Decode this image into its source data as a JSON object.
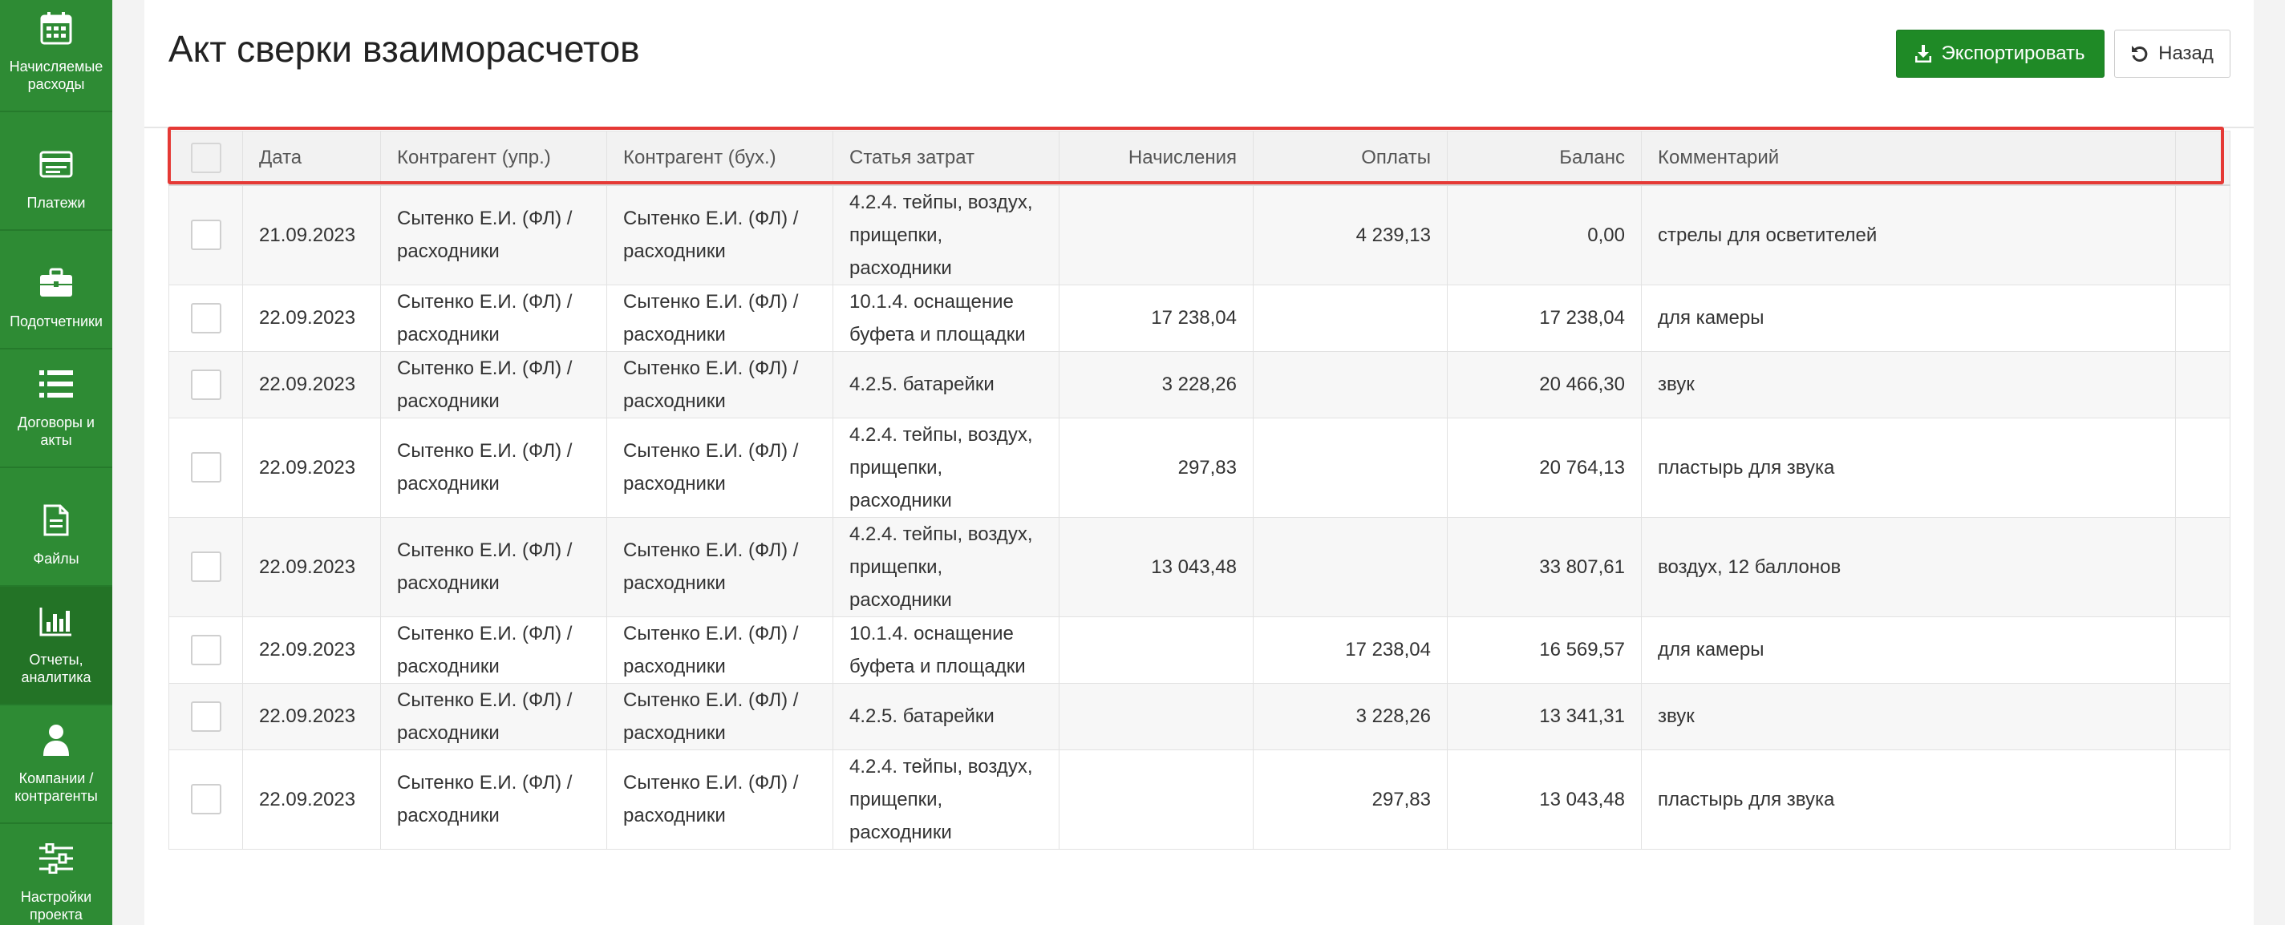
{
  "sidebar": {
    "items": [
      {
        "label": "Начисляемые\nрасходы",
        "icon": "calendar-icon"
      },
      {
        "label": "Платежи",
        "icon": "payments-icon"
      },
      {
        "label": "Подотчетники",
        "icon": "briefcase-icon"
      },
      {
        "label": "Договоры и\nакты",
        "icon": "list-icon"
      },
      {
        "label": "Файлы",
        "icon": "file-icon"
      },
      {
        "label": "Отчеты,\nаналитика",
        "icon": "bar-chart-icon"
      },
      {
        "label": "Компании /\nконтрагенты",
        "icon": "user-icon"
      },
      {
        "label": "Настройки\nпроекта",
        "icon": "sliders-icon"
      }
    ]
  },
  "page": {
    "title": "Акт сверки взаиморасчетов",
    "export_label": "Экспортировать",
    "back_label": "Назад"
  },
  "table": {
    "headers": [
      "Дата",
      "Контрагент (упр.)",
      "Контрагент (бух.)",
      "Статья затрат",
      "Начисления",
      "Оплаты",
      "Баланс",
      "Комментарий"
    ],
    "rows": [
      {
        "date": "21.09.2023",
        "contr_mgmt": "Сытенко Е.И. (ФЛ) / расходники",
        "contr_acc": "Сытенко Е.И. (ФЛ) / расходники",
        "article": "4.2.4. тейпы, воздух, прищепки, расходники",
        "accrual": "",
        "payment": "4 239,13",
        "balance": "0,00",
        "comment": "стрелы для осветителей"
      },
      {
        "date": "22.09.2023",
        "contr_mgmt": "Сытенко Е.И. (ФЛ) / расходники",
        "contr_acc": "Сытенко Е.И. (ФЛ) / расходники",
        "article": "10.1.4. оснащение буфета и площадки",
        "accrual": "17 238,04",
        "payment": "",
        "balance": "17 238,04",
        "comment": "для камеры"
      },
      {
        "date": "22.09.2023",
        "contr_mgmt": "Сытенко Е.И. (ФЛ) / расходники",
        "contr_acc": "Сытенко Е.И. (ФЛ) / расходники",
        "article": "4.2.5. батарейки",
        "accrual": "3 228,26",
        "payment": "",
        "balance": "20 466,30",
        "comment": "звук"
      },
      {
        "date": "22.09.2023",
        "contr_mgmt": "Сытенко Е.И. (ФЛ) / расходники",
        "contr_acc": "Сытенко Е.И. (ФЛ) / расходники",
        "article": "4.2.4. тейпы, воздух, прищепки, расходники",
        "accrual": "297,83",
        "payment": "",
        "balance": "20 764,13",
        "comment": "пластырь для звука"
      },
      {
        "date": "22.09.2023",
        "contr_mgmt": "Сытенко Е.И. (ФЛ) / расходники",
        "contr_acc": "Сытенко Е.И. (ФЛ) / расходники",
        "article": "4.2.4. тейпы, воздух, прищепки, расходники",
        "accrual": "13 043,48",
        "payment": "",
        "balance": "33 807,61",
        "comment": "воздух, 12 баллонов"
      },
      {
        "date": "22.09.2023",
        "contr_mgmt": "Сытенко Е.И. (ФЛ) / расходники",
        "contr_acc": "Сытенко Е.И. (ФЛ) / расходники",
        "article": "10.1.4. оснащение буфета и площадки",
        "accrual": "",
        "payment": "17 238,04",
        "balance": "16 569,57",
        "comment": "для камеры"
      },
      {
        "date": "22.09.2023",
        "contr_mgmt": "Сытенко Е.И. (ФЛ) / расходники",
        "contr_acc": "Сытенко Е.И. (ФЛ) / расходники",
        "article": "4.2.5. батарейки",
        "accrual": "",
        "payment": "3 228,26",
        "balance": "13 341,31",
        "comment": "звук"
      },
      {
        "date": "22.09.2023",
        "contr_mgmt": "Сытенко Е.И. (ФЛ) / расходники",
        "contr_acc": "Сытенко Е.И. (ФЛ) / расходники",
        "article": "4.2.4. тейпы, воздух, прищепки, расходники",
        "accrual": "",
        "payment": "297,83",
        "balance": "13 043,48",
        "comment": "пластырь для звука"
      }
    ]
  },
  "colors": {
    "sidebar": "#2e8b34",
    "primary_button": "#1f8a26",
    "highlight": "#e53935"
  }
}
